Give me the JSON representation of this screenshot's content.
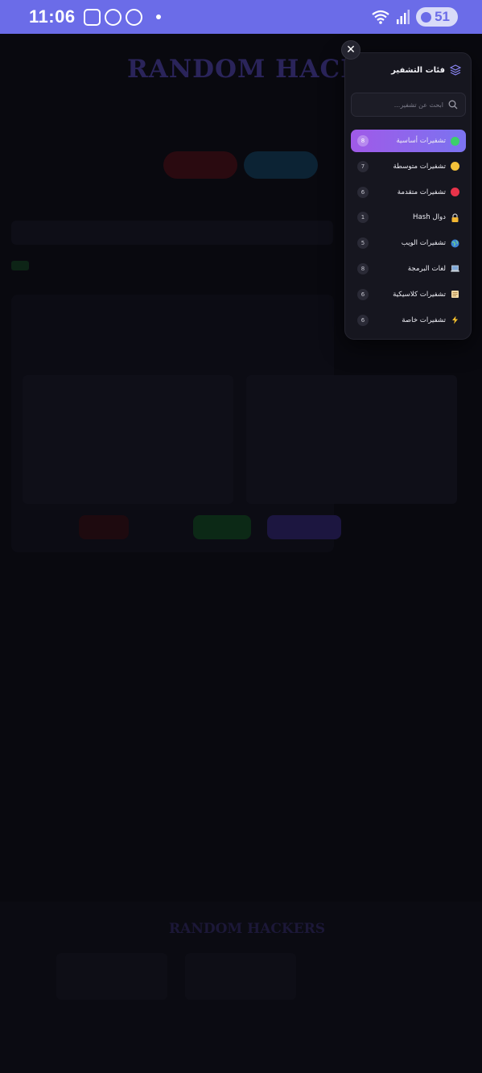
{
  "status_bar": {
    "time": "11:06",
    "battery": "51"
  },
  "background": {
    "hero_title": "RANDOM HACKER",
    "footer_title": "RANDOM HACKERS"
  },
  "drawer": {
    "title": "فئات التشفير",
    "close_label": "✕",
    "search_placeholder": "ابحث عن تشفير...",
    "categories": [
      {
        "label": "تشفيرات أساسية",
        "count": "8",
        "icon": "green-circle",
        "active": true
      },
      {
        "label": "تشفيرات متوسطة",
        "count": "7",
        "icon": "yellow-circle"
      },
      {
        "label": "تشفيرات متقدمة",
        "count": "6",
        "icon": "red-circle"
      },
      {
        "label": "دوال Hash",
        "count": "1",
        "icon": "lock"
      },
      {
        "label": "تشفيرات الويب",
        "count": "5",
        "icon": "globe"
      },
      {
        "label": "لغات البرمجة",
        "count": "8",
        "icon": "laptop"
      },
      {
        "label": "تشفيرات كلاسيكية",
        "count": "6",
        "icon": "scroll"
      },
      {
        "label": "تشفيرات خاصة",
        "count": "6",
        "icon": "lightning"
      }
    ],
    "colors": {
      "active_gradient_start": "#a05ae8",
      "active_gradient_end": "#7b73f0"
    }
  }
}
